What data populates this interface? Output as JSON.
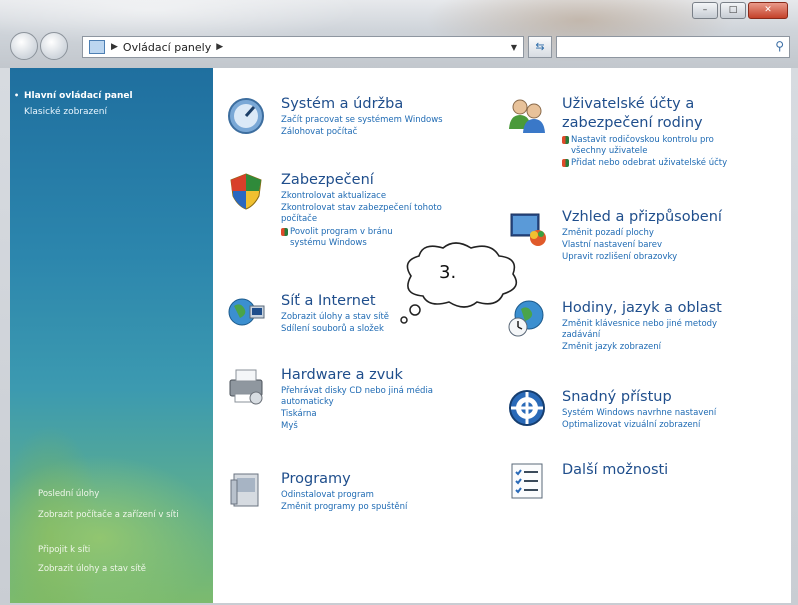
{
  "window": {
    "controls": {
      "minimize": "–",
      "maximize": "□",
      "close": "✕"
    }
  },
  "address_bar": {
    "path_label": "Ovládací panely",
    "search_placeholder": ""
  },
  "sidebar": {
    "top_links": [
      "Hlavní ovládací panel",
      "Klasické zobrazení"
    ],
    "bottom_links": [
      "Poslední úlohy",
      "Zobrazit počítače a zařízení v síti",
      "Připojit k síti",
      "Zobrazit úlohy a stav sítě"
    ]
  },
  "categories": {
    "system": {
      "title": "Systém a údržba",
      "links": [
        "Začít pracovat se systémem Windows",
        "Zálohovat počítač"
      ]
    },
    "security": {
      "title": "Zabezpečení",
      "links": [
        "Zkontrolovat aktualizace",
        "Zkontrolovat stav zabezpečení tohoto",
        "počítače",
        "Povolit program v bránu",
        "systému Windows"
      ]
    },
    "network": {
      "title": "Síť a Internet",
      "links": [
        "Zobrazit úlohy a stav sítě",
        "Sdílení souborů a složek"
      ]
    },
    "hardware": {
      "title": "Hardware a zvuk",
      "links": [
        "Přehrávat disky CD nebo jiná média",
        "automaticky",
        "Tiskárna",
        "Myš"
      ]
    },
    "programs": {
      "title": "Programy",
      "links": [
        "Odinstalovat program",
        "Změnit programy po spuštění"
      ]
    },
    "users": {
      "title_line1": "Uživatelské účty a",
      "title_line2": "zabezpečení rodiny",
      "links": [
        "Nastavit rodičovskou kontrolu pro",
        "všechny uživatele",
        "Přidat nebo odebrat uživatelské účty"
      ]
    },
    "appearance": {
      "title": "Vzhled a přizpůsobení",
      "links": [
        "Změnit pozadí plochy",
        "Vlastní nastavení barev",
        "Upravit rozlišení obrazovky"
      ]
    },
    "clock": {
      "title": "Hodiny, jazyk a oblast",
      "links": [
        "Změnit klávesnice nebo jiné metody",
        "zadávání",
        "Změnit jazyk zobrazení"
      ]
    },
    "access": {
      "title": "Snadný přístup",
      "links": [
        "Systém Windows navrhne nastavení",
        "Optimalizovat vizuální zobrazení"
      ]
    },
    "more": {
      "title": "Další možnosti"
    }
  },
  "callout": {
    "label": "3."
  }
}
